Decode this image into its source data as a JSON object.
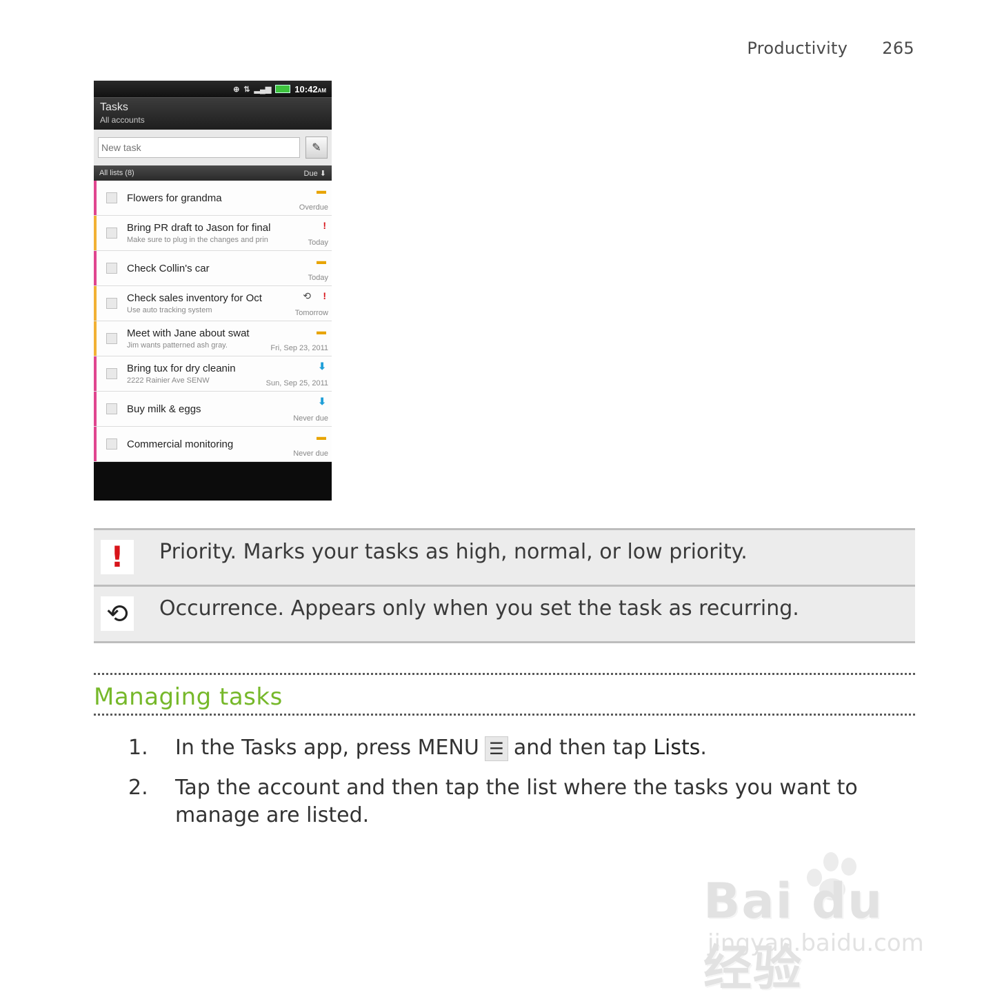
{
  "header": {
    "section": "Productivity",
    "page_number": "265"
  },
  "phone": {
    "statusbar": {
      "time": "10:42",
      "ampm": "AM"
    },
    "title": "Tasks",
    "subtitle": "All accounts",
    "new_task_placeholder": "New task",
    "list_header": {
      "left": "All lists (8)",
      "right": "Due"
    },
    "tasks": [
      {
        "title": "Flowers for grandma",
        "sub": "",
        "due": "Overdue",
        "priority": "normal",
        "bar_color": "#e0458f",
        "recurring": false
      },
      {
        "title": "Bring PR draft to Jason for final a",
        "sub": "Make sure to plug in the changes and prin",
        "due": "Today",
        "priority": "high",
        "bar_color": "#f2b134",
        "recurring": false
      },
      {
        "title": "Check Collin's car",
        "sub": "",
        "due": "Today",
        "priority": "normal",
        "bar_color": "#e0458f",
        "recurring": false
      },
      {
        "title": "Check sales inventory for Oct",
        "sub": "Use auto tracking system",
        "due": "Tomorrow",
        "priority": "high",
        "bar_color": "#f2b134",
        "recurring": true
      },
      {
        "title": "Meet with Jane about swat",
        "sub": "Jim wants patterned ash gray.",
        "due": "Fri, Sep 23, 2011",
        "priority": "normal",
        "bar_color": "#f2b134",
        "recurring": false
      },
      {
        "title": "Bring tux for dry cleanin",
        "sub": "2222 Rainier Ave SENW",
        "due": "Sun, Sep 25, 2011",
        "priority": "low",
        "bar_color": "#e0458f",
        "recurring": false
      },
      {
        "title": "Buy milk & eggs",
        "sub": "",
        "due": "Never due",
        "priority": "low",
        "bar_color": "#e0458f",
        "recurring": false
      },
      {
        "title": "Commercial monitoring",
        "sub": "",
        "due": "Never due",
        "priority": "normal",
        "bar_color": "#e0458f",
        "recurring": false
      }
    ]
  },
  "legend": [
    {
      "icon": "priority-icon",
      "text": "Priority. Marks your tasks as high, normal, or low priority."
    },
    {
      "icon": "occurrence-icon",
      "text": "Occurrence. Appears only when you set the task as recurring."
    }
  ],
  "section_title": "Managing tasks",
  "steps": [
    {
      "num": "1.",
      "before": "In the Tasks app, press MENU",
      "after": "and then tap",
      "bold": "Lists",
      "end": "."
    },
    {
      "num": "2.",
      "text": "Tap the account and then tap the list where the tasks you want to manage are listed."
    }
  ],
  "watermark": {
    "brand": "Bai du 经验",
    "url": "jingyan.baidu.com"
  },
  "colors": {
    "accent_green": "#76b82a",
    "priority_high": "#d8141a",
    "priority_normal": "#e8a400",
    "priority_low": "#1f9fd8"
  }
}
